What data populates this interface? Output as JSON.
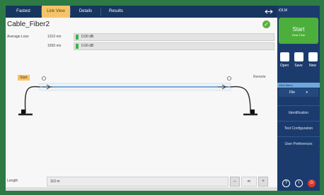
{
  "tabs": [
    "Fastest",
    "Link View",
    "Details",
    "Results"
  ],
  "active_tab_index": 1,
  "cable_name": "Cable_Fiber2",
  "average_loss": {
    "label": "Average Loss",
    "rows": [
      {
        "wavelength": "1310 nm",
        "value": "0.00 dB"
      },
      {
        "wavelength": "1550 nm",
        "value": "0.00 dB"
      }
    ]
  },
  "diagram": {
    "start_label": "Start",
    "end_label": "Remote"
  },
  "length": {
    "label": "Length",
    "value": "110 m",
    "unit": "m"
  },
  "app_name": "iOLM",
  "start_button": {
    "label": "Start",
    "sublabel": "Real-Time"
  },
  "file_buttons": [
    "Open",
    "Save",
    "New"
  ],
  "view_header": "View Menu",
  "view_select": "File",
  "menu_items": [
    "Identification",
    "Test Configuration",
    "User Preferences"
  ],
  "bottom_icons": [
    "help-icon",
    "info-icon",
    "power-icon"
  ],
  "colors": {
    "accent_green": "#4caf3b",
    "tab_active": "#f5c46a",
    "nav_blue": "#1b3b6d"
  }
}
